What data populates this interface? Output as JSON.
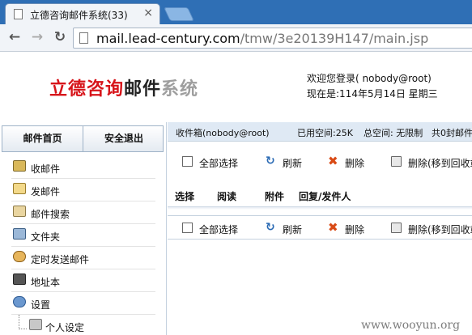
{
  "browser": {
    "tab_title": "立德咨询邮件系统(33)",
    "tab_close": "×",
    "url_prefix": "mail.lead-century.com",
    "url_path": "/tmw/3e20139H147/main.jsp"
  },
  "header": {
    "logo_part1": "立德咨询",
    "logo_part2": "邮件",
    "logo_part3": "系统",
    "welcome_line": "欢迎您登录(  nobody@root)",
    "date_line": "现在是:114年5月14日  星期三"
  },
  "leftnav": {
    "tabs": [
      "邮件首页",
      "安全退出"
    ],
    "items": [
      {
        "label": "收邮件",
        "icon": "inbox-icon"
      },
      {
        "label": "发邮件",
        "icon": "compose-icon"
      },
      {
        "label": "邮件搜索",
        "icon": "search-mail-icon"
      },
      {
        "label": "文件夹",
        "icon": "folder-icon"
      },
      {
        "label": "定时发送邮件",
        "icon": "clock-icon"
      },
      {
        "label": "地址本",
        "icon": "address-book-icon"
      },
      {
        "label": "设置",
        "icon": "gear-icon"
      },
      {
        "label": "个人设定",
        "icon": "personal-settings-icon"
      }
    ]
  },
  "main": {
    "mailbox_label": "收件箱(nobody@root)",
    "used_space": "已用空间:25K",
    "total_space": "总空间: 无限制",
    "mail_count": "共0封邮件",
    "actions": {
      "select_all": "全部选择",
      "refresh": "刷新",
      "delete": "删除",
      "delete_move": "删除(移到回收站)"
    },
    "columns": [
      "选择",
      "阅读",
      "附件",
      "回复/发件人"
    ]
  },
  "watermark": "www.wooyun.org",
  "colors": {
    "chrome_blue": "#2f6fb5",
    "logo_red": "#d7141a",
    "infobar_bg": "#dfe9f4"
  }
}
